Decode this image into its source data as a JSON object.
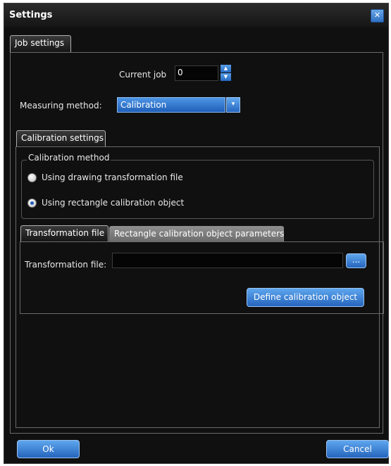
{
  "window": {
    "title": "Settings",
    "close_glyph": "✕"
  },
  "tabs_main": {
    "job_settings": "Job settings"
  },
  "job": {
    "current_job_label": "Current job",
    "current_job_value": "0",
    "spin_up": "▲",
    "spin_down": "▼",
    "measuring_method_label": "Measuring method:",
    "measuring_method_value": "Calibration",
    "combo_arrow": "▾"
  },
  "calibration": {
    "tab_label": "Calibration settings",
    "method_group_label": "Calibration method",
    "options": [
      {
        "label": "Using drawing transformation file",
        "checked": false
      },
      {
        "label": "Using rectangle calibration object",
        "checked": true
      }
    ],
    "subtabs": {
      "transformation_file": "Transformation file",
      "rectangle_params": "Rectangle calibration object parameters"
    },
    "transformation_file_label": "Transformation file:",
    "transformation_file_value": "",
    "browse_label": "...",
    "define_button": "Define calibration object"
  },
  "footer": {
    "ok": "Ok",
    "cancel": "Cancel"
  }
}
